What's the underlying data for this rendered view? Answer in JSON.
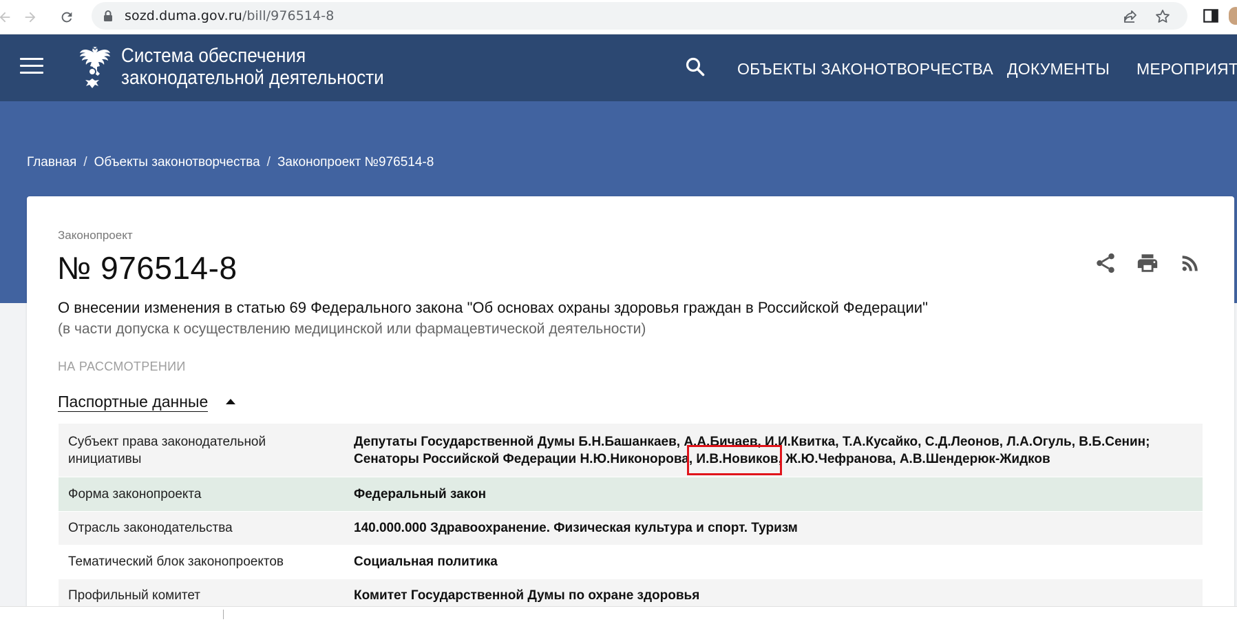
{
  "browser": {
    "url_host": "sozd.duma.gov.ru",
    "url_path": "/bill/976514-8"
  },
  "header": {
    "site_title_line1": "Система обеспечения",
    "site_title_line2": "законодательной деятельности",
    "nav": [
      "ОБЪЕКТЫ ЗАКОНОТВОРЧЕСТВА",
      "ДОКУМЕНТЫ",
      "МЕРОПРИЯТИ"
    ],
    "colors": {
      "header_bg": "#2c4872",
      "band_bg": "#4163a0"
    }
  },
  "breadcrumb": {
    "items": [
      "Главная",
      "Объекты законотворчества",
      "Законопроект №976514-8"
    ],
    "separator": "/"
  },
  "bill": {
    "kicker": "Законопроект",
    "number": "№ 976514-8",
    "title": "О внесении изменения в статью 69 Федерального закона \"Об основах охраны здоровья граждан в Российской Федерации\"",
    "subtitle": "(в части допуска к осуществлению медицинской или фармацевтической деятельности)",
    "status": "НА РАССМОТРЕНИИ",
    "passport_heading": "Паспортные данные"
  },
  "passport": [
    {
      "label_line1": "Субъект права законодательной",
      "label_line2": "инициативы",
      "value_line1": "Депутаты Государственной Думы Б.Н.Башанкаев, А.А.Бичаев, И.И.Квитка, Т.А.Кусайко, С.Д.Леонов, Л.А.Огуль, В.Б.Сенин;",
      "value_line2": "Сенаторы Российской Федерации Н.Ю.Никонорова, И.В.Новиков, Ж.Ю.Чефранова, А.В.Шендерюк-Жидков"
    },
    {
      "label": "Форма законопроекта",
      "value": "Федеральный закон"
    },
    {
      "label": "Отрасль законодательства",
      "value": "140.000.000 Здравоохранение. Физическая культура и спорт. Туризм"
    },
    {
      "label": "Тематический блок законопроектов",
      "value": "Социальная политика"
    },
    {
      "label": "Профильный комитет",
      "value": "Комитет Государственной Думы по охране здоровья"
    }
  ],
  "icons": [
    "back-icon",
    "forward-icon",
    "reload-icon",
    "lock-icon",
    "share-icon",
    "star-icon",
    "sidebar-icon",
    "menu-icon",
    "emblem-icon",
    "search-icon",
    "print-icon",
    "rss-icon",
    "caret-up-icon"
  ],
  "annotation": {
    "highlight_color": "#e0141b"
  }
}
